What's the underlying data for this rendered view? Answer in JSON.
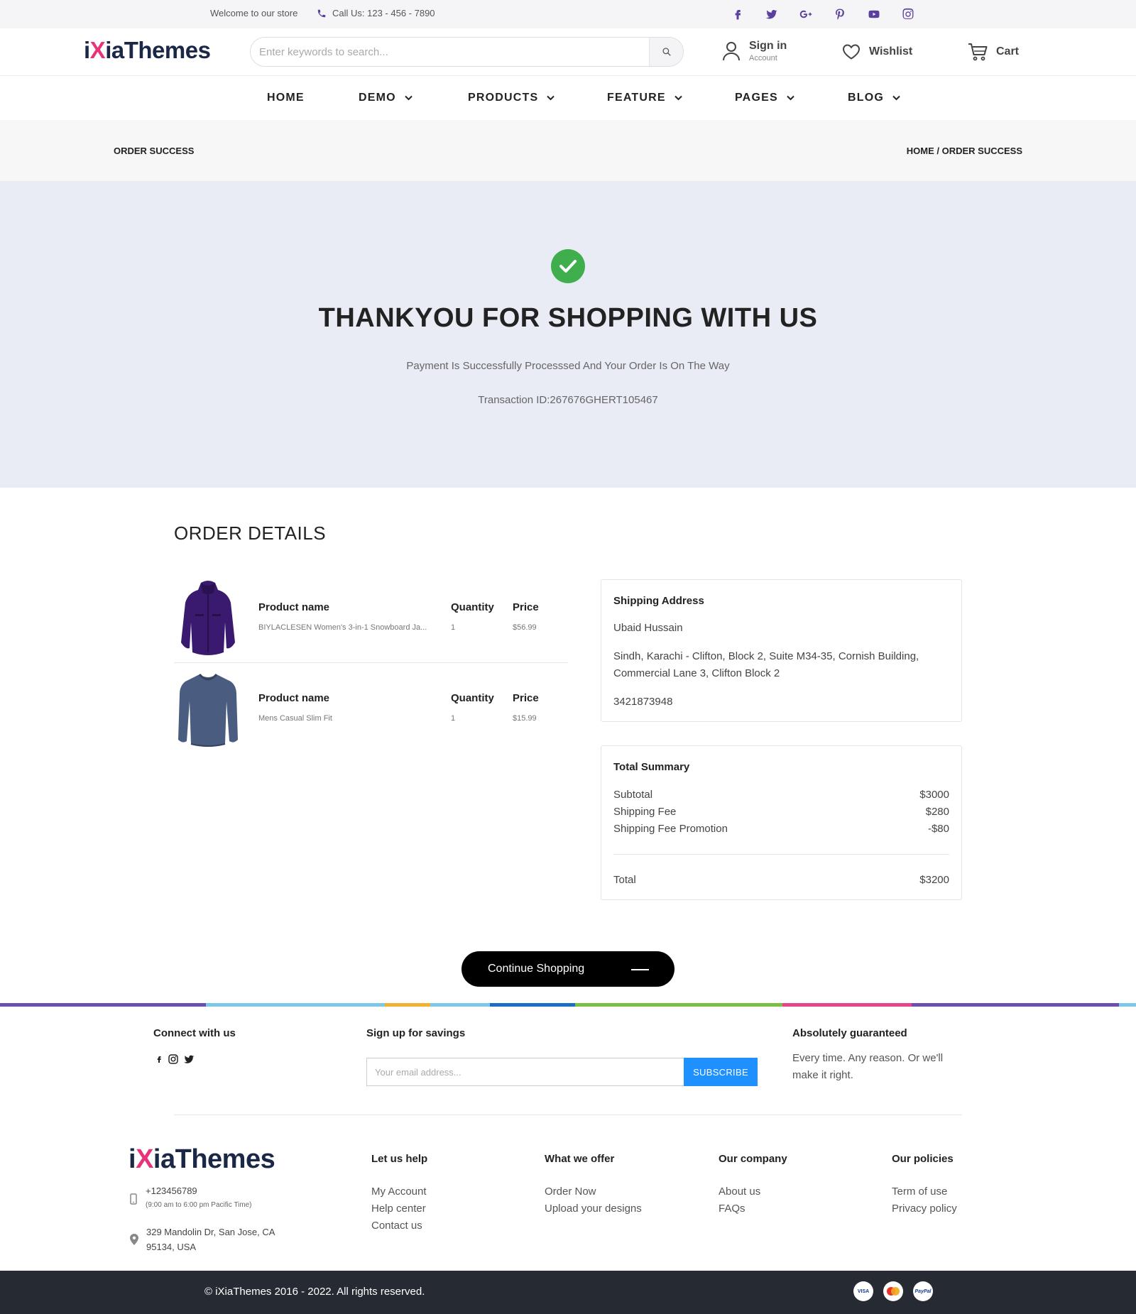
{
  "topbar": {
    "welcome": "Welcome to our store",
    "phone": "Call Us: 123 - 456 - 7890",
    "social_icons": [
      "facebook-icon",
      "twitter-icon",
      "google-plus-icon",
      "pinterest-icon",
      "youtube-icon",
      "instagram-icon"
    ]
  },
  "header": {
    "logo_prefix": "i",
    "logo_x": "X",
    "logo_rest": "iaThemes",
    "search_placeholder": "Enter keywords to search...",
    "signin_label": "Sign in",
    "signin_sub": "Account",
    "wishlist_label": "Wishlist",
    "cart_label": "Cart"
  },
  "nav": {
    "items": [
      {
        "label": "HOME"
      },
      {
        "label": "DEMO"
      },
      {
        "label": "PRODUCTS"
      },
      {
        "label": "FEATURE"
      },
      {
        "label": "PAGES"
      },
      {
        "label": "BLOG"
      }
    ]
  },
  "breadcrumb": {
    "page": "ORDER SUCCESS",
    "path": "HOME / ORDER SUCCESS"
  },
  "hero": {
    "title": "THANKYOU FOR SHOPPING WITH US",
    "message": "Payment Is Successfully Processsed And Your Order Is On The Way",
    "transaction": "Transaction ID:267676GHERT105467"
  },
  "order": {
    "title": "ORDER DETAILS",
    "col_name": "Product name",
    "col_qty": "Quantity",
    "col_price": "Price",
    "products": [
      {
        "name": "BIYLACLESEN Women's 3-in-1 Snowboard Ja...",
        "qty": "1",
        "price": "$56.99"
      },
      {
        "name": "Mens Casual Slim Fit",
        "qty": "1",
        "price": "$15.99"
      }
    ]
  },
  "shipping": {
    "title": "Shipping Address",
    "name": "Ubaid Hussain",
    "address_line1": "Sindh, Karachi - Clifton, Block 2, Suite M34-35, Cornish Building,",
    "address_line2": "Commercial Lane 3, Clifton Block 2",
    "phone": "3421873948"
  },
  "summary": {
    "title": "Total Summary",
    "rows": [
      {
        "label": "Subtotal",
        "value": "$3000"
      },
      {
        "label": "Shipping Fee",
        "value": "$280"
      },
      {
        "label": "Shipping Fee Promotion",
        "value": "-$80"
      }
    ],
    "total_label": "Total",
    "total_value": "$3200"
  },
  "continue_label": "Continue Shopping",
  "footer": {
    "connect_title": "Connect with us",
    "connect_icons": [
      "facebook-icon",
      "instagram-icon",
      "twitter-icon"
    ],
    "signup_title": "Sign up for savings",
    "email_placeholder": "Your email address...",
    "subscribe_label": "SUBSCRIBE",
    "guarantee_title": "Absolutely guaranteed",
    "guarantee_line1": "Every time. Any reason. Or we'll",
    "guarantee_line2": "make it right.",
    "phone": "+123456789",
    "hours": "(9:00 am to 6:00 pm Pacific Time)",
    "address_line1": "329 Mandolin Dr, San Jose, CA",
    "address_line2": "95134, USA",
    "columns": [
      {
        "title": "Let us help",
        "links": [
          "My Account",
          "Help center",
          "Contact us"
        ]
      },
      {
        "title": "What we offer",
        "links": [
          "Order Now",
          "Upload your designs"
        ]
      },
      {
        "title": "Our company",
        "links": [
          "About us",
          "FAQs"
        ]
      },
      {
        "title": "Our policies",
        "links": [
          "Term of use",
          "Privacy policy"
        ]
      }
    ],
    "copyright": "© iXiaThemes 2016 - 2022. All rights reserved.",
    "payments": [
      {
        "icon": "visa-icon",
        "text": "VISA"
      },
      {
        "icon": "mastercard-icon",
        "text": ""
      },
      {
        "icon": "paypal-icon",
        "text": "PayPal"
      }
    ]
  },
  "colors": {
    "accent": "#5b3fa0",
    "logo_dark": "#1b2746",
    "logo_pink": "#e8327a",
    "hero_bg": "#e9ebf5",
    "success": "#3fae4c",
    "subscribe": "#1e90ff",
    "footer_bottom": "#262b33"
  }
}
